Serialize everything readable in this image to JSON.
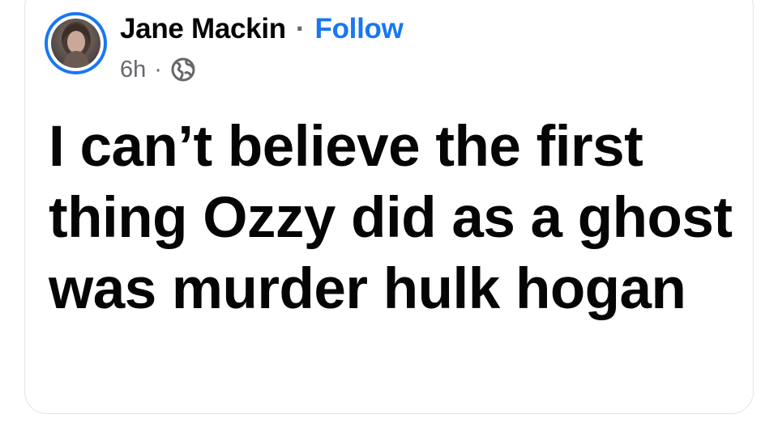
{
  "post": {
    "author": {
      "name": "Jane Mackin",
      "separator": "·",
      "follow_label": "Follow",
      "avatar_icon": "profile-photo"
    },
    "meta": {
      "timestamp": "6h",
      "separator": "·",
      "audience_icon": "globe-icon"
    },
    "text": "I can’t believe the first thing Ozzy did as a ghost was murder hulk hogan"
  },
  "colors": {
    "accent": "#1877f2",
    "text_primary": "#050505",
    "text_secondary": "#65676b",
    "border": "#e2e3e6",
    "background": "#ffffff"
  }
}
